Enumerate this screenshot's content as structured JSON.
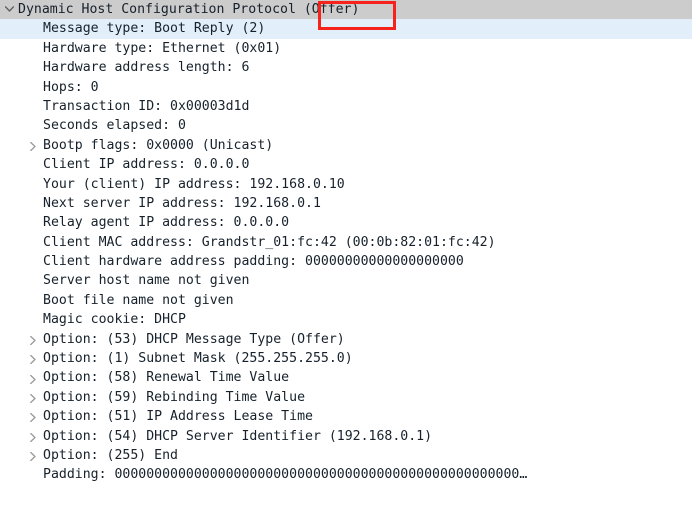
{
  "panel": {
    "name": "packet-details-tree",
    "colors": {
      "selected_row_bg": "#cccccc",
      "highlight_row_bg": "#e2effb",
      "text": "#16212b",
      "twisty": "#9a9a9a",
      "annotation_red": "#f5231b",
      "background": "#ffffff"
    }
  },
  "annotation": {
    "name": "red-highlight-box",
    "target_text": "(Offer)"
  },
  "rows": [
    {
      "text": "Dynamic Host Configuration Protocol (Offer)",
      "level": 0,
      "twisty": "expanded",
      "state": "selected",
      "name": "tree-row-dhcp-root"
    },
    {
      "text": "Message type: Boot Reply (2)",
      "level": 1,
      "twisty": "none",
      "state": "highlight",
      "name": "tree-row-message-type"
    },
    {
      "text": "Hardware type: Ethernet (0x01)",
      "level": 1,
      "twisty": "none",
      "state": "normal",
      "name": "tree-row-hardware-type"
    },
    {
      "text": "Hardware address length: 6",
      "level": 1,
      "twisty": "none",
      "state": "normal",
      "name": "tree-row-hardware-address-length"
    },
    {
      "text": "Hops: 0",
      "level": 1,
      "twisty": "none",
      "state": "normal",
      "name": "tree-row-hops"
    },
    {
      "text": "Transaction ID: 0x00003d1d",
      "level": 1,
      "twisty": "none",
      "state": "normal",
      "name": "tree-row-transaction-id"
    },
    {
      "text": "Seconds elapsed: 0",
      "level": 1,
      "twisty": "none",
      "state": "normal",
      "name": "tree-row-seconds-elapsed"
    },
    {
      "text": "Bootp flags: 0x0000 (Unicast)",
      "level": 1,
      "twisty": "collapsed",
      "state": "normal",
      "name": "tree-row-bootp-flags"
    },
    {
      "text": "Client IP address: 0.0.0.0",
      "level": 1,
      "twisty": "none",
      "state": "normal",
      "name": "tree-row-client-ip-address"
    },
    {
      "text": "Your (client) IP address: 192.168.0.10",
      "level": 1,
      "twisty": "none",
      "state": "normal",
      "name": "tree-row-your-client-ip-address"
    },
    {
      "text": "Next server IP address: 192.168.0.1",
      "level": 1,
      "twisty": "none",
      "state": "normal",
      "name": "tree-row-next-server-ip-address"
    },
    {
      "text": "Relay agent IP address: 0.0.0.0",
      "level": 1,
      "twisty": "none",
      "state": "normal",
      "name": "tree-row-relay-agent-ip-address"
    },
    {
      "text": "Client MAC address: Grandstr_01:fc:42 (00:0b:82:01:fc:42)",
      "level": 1,
      "twisty": "none",
      "state": "normal",
      "name": "tree-row-client-mac-address"
    },
    {
      "text": "Client hardware address padding: 00000000000000000000",
      "level": 1,
      "twisty": "none",
      "state": "normal",
      "name": "tree-row-client-hardware-address-padding"
    },
    {
      "text": "Server host name not given",
      "level": 1,
      "twisty": "none",
      "state": "normal",
      "name": "tree-row-server-host-name"
    },
    {
      "text": "Boot file name not given",
      "level": 1,
      "twisty": "none",
      "state": "normal",
      "name": "tree-row-boot-file-name"
    },
    {
      "text": "Magic cookie: DHCP",
      "level": 1,
      "twisty": "none",
      "state": "normal",
      "name": "tree-row-magic-cookie"
    },
    {
      "text": "Option: (53) DHCP Message Type (Offer)",
      "level": 1,
      "twisty": "collapsed",
      "state": "normal",
      "name": "tree-row-option-53"
    },
    {
      "text": "Option: (1) Subnet Mask (255.255.255.0)",
      "level": 1,
      "twisty": "collapsed",
      "state": "normal",
      "name": "tree-row-option-1"
    },
    {
      "text": "Option: (58) Renewal Time Value",
      "level": 1,
      "twisty": "collapsed",
      "state": "normal",
      "name": "tree-row-option-58"
    },
    {
      "text": "Option: (59) Rebinding Time Value",
      "level": 1,
      "twisty": "collapsed",
      "state": "normal",
      "name": "tree-row-option-59"
    },
    {
      "text": "Option: (51) IP Address Lease Time",
      "level": 1,
      "twisty": "collapsed",
      "state": "normal",
      "name": "tree-row-option-51"
    },
    {
      "text": "Option: (54) DHCP Server Identifier (192.168.0.1)",
      "level": 1,
      "twisty": "collapsed",
      "state": "normal",
      "name": "tree-row-option-54"
    },
    {
      "text": "Option: (255) End",
      "level": 1,
      "twisty": "collapsed",
      "state": "normal",
      "name": "tree-row-option-255"
    },
    {
      "text": "Padding: 000000000000000000000000000000000000000000000000000…",
      "level": 1,
      "twisty": "none",
      "state": "normal",
      "name": "tree-row-padding"
    }
  ]
}
